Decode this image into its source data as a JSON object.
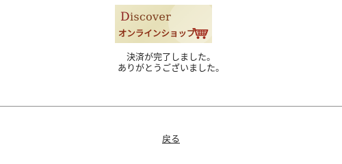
{
  "logo": {
    "brand_first": "D",
    "brand_rest": "iscover",
    "shop_name": "オンラインショップ",
    "cart_icon": "shopping-cart-icon",
    "colors": {
      "background": "#ede8c8",
      "brand": "#7a3a1a",
      "shop": "#8b2d14",
      "cart": "#a0281a"
    }
  },
  "message": {
    "line1": "決済が完了しました。",
    "line2": "ありがとうございました。"
  },
  "footer": {
    "back_label": "戻る"
  }
}
